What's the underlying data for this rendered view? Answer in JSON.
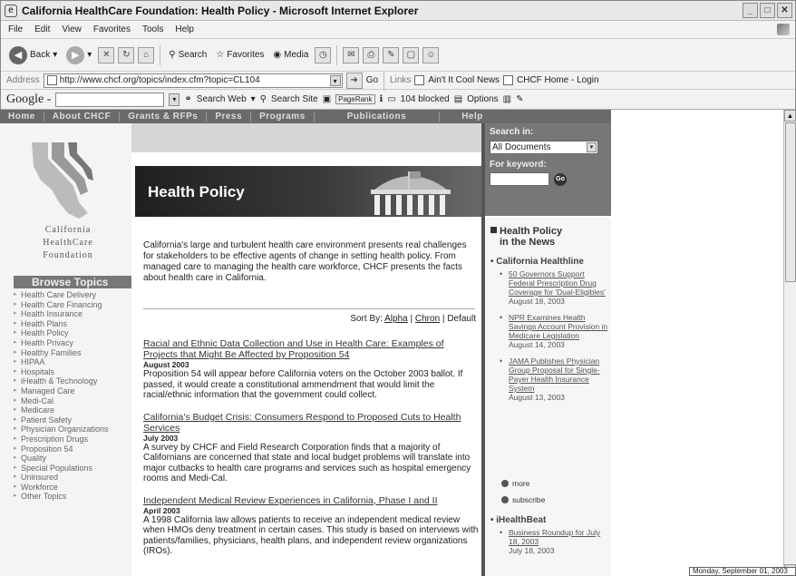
{
  "window": {
    "title": "California HealthCare Foundation: Health Policy - Microsoft Internet Explorer"
  },
  "menu": [
    "File",
    "Edit",
    "View",
    "Favorites",
    "Tools",
    "Help"
  ],
  "toolbar": {
    "back": "Back",
    "search": "Search",
    "favorites": "Favorites",
    "media": "Media"
  },
  "address": {
    "label": "Address",
    "url": "http://www.chcf.org/topics/index.cfm?topic=CL104",
    "go": "Go",
    "links_label": "Links",
    "link1": "Ain't It Cool News",
    "link2": "CHCF Home - Login"
  },
  "google": {
    "logo": "Google -",
    "search_web": "Search Web",
    "search_site": "Search Site",
    "pagerank": "PageRank",
    "blocked": "104 blocked",
    "options": "Options"
  },
  "site_nav": [
    "Home",
    "About CHCF",
    "Grants & RFPs",
    "Press",
    "Programs",
    "Publications",
    "Help"
  ],
  "logo": {
    "line1": "California",
    "line2": "HealthCare",
    "line3": "Foundation"
  },
  "browse": {
    "title": "Browse Topics",
    "topics": [
      "Health Care Delivery",
      "Health Care Financing",
      "Health Insurance",
      "Health Plans",
      "Health Policy",
      "Health Privacy",
      "Healthy Families",
      "HIPAA",
      "Hospitals",
      "iHealth & Technology",
      "Managed Care",
      "Medi-Cal",
      "Medicare",
      "Patient Safety",
      "Physician Organizations",
      "Prescription Drugs",
      "Proposition 54",
      "Quality",
      "Special Populations",
      "Uninsured",
      "Workforce",
      "Other Topics"
    ]
  },
  "main": {
    "title": "Health Policy",
    "intro": "California's large and turbulent health care environment presents real challenges for stakeholders to be effective agents of change in setting health policy. From managed care to managing the health care workforce, CHCF presents the facts about health care in California.",
    "sort": {
      "label": "Sort By:",
      "alpha": "Alpha",
      "sep1": "|",
      "chron": "Chron",
      "sep2": "|",
      "default": "Default"
    },
    "articles": [
      {
        "title": "Racial and Ethnic Data Collection and Use in Health Care: Examples of Projects that Might Be Affected by Proposition 54",
        "date": "August 2003",
        "summary": "Proposition 54 will appear before California voters on the October 2003 ballot. If passed, it would create a constitutional ammendment that would limit the racial/ethnic information that the government could collect."
      },
      {
        "title": "California's Budget Crisis: Consumers Respond to Proposed Cuts to Health Services",
        "date": "July 2003",
        "summary": "A survey by CHCF and Field Research Corporation finds that a majority of Californians are concerned that state and local budget problems will translate into major cutbacks to health care programs and services such as hospital emergency rooms and Medi-Cal."
      },
      {
        "title": "Independent Medical Review Experiences in California, Phase I and II",
        "date": "April 2003",
        "summary": "A 1998 California law allows patients to receive an independent medical review when HMOs deny treatment in certain cases. This study is based on interviews with patients/families, physicians, health plans, and independent review organizations (IROs)."
      }
    ]
  },
  "search": {
    "label": "Search in:",
    "option": "All Documents",
    "keyword_label": "For keyword:",
    "go": "Go"
  },
  "news": {
    "heading1": "Health Policy",
    "heading2": "in the News",
    "source1": "• California Healthline",
    "items": [
      {
        "title": "50 Governors Support Federal Prescription Drug Coverage for 'Dual-Eligibles'",
        "date": "August 18, 2003"
      },
      {
        "title": "NPR Examines Health Savings Account Provision in Medicare Legislation",
        "date": "August 14, 2003"
      },
      {
        "title": "JAMA Publishes Physician Group Proposal for Single-Payer Health Insurance System",
        "date": "August 13, 2003"
      }
    ],
    "more": "more",
    "subscribe": "subscribe",
    "source2": "• iHealthBeat",
    "items2": [
      {
        "title": "Business Roundup for July 18, 2003",
        "date": "July 18, 2003"
      }
    ]
  },
  "status": {
    "clock": "Monday, September 01, 2003"
  }
}
